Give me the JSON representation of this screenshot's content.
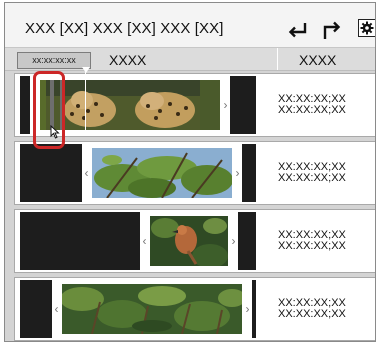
{
  "toolbar": {
    "title": "XXX [XX]  XXX [XX]  XXX [XX]",
    "icons": [
      "undo-arrow-icon",
      "redo-arrow-icon",
      "gear-icon"
    ]
  },
  "columns": {
    "timecode_chip": "xx:xx:xx:xx",
    "name": "XXXX",
    "time": "XXXX"
  },
  "rows": [
    {
      "thumbnail": "leopard-clip",
      "time_in": "XX:XX:XX;XX",
      "time_out": "XX:XX:XX;XX"
    },
    {
      "thumbnail": "tree-canopy-clip",
      "time_in": "XX:XX:XX;XX",
      "time_out": "XX:XX:XX;XX"
    },
    {
      "thumbnail": "bird-clip",
      "time_in": "XX:XX:XX;XX",
      "time_out": "XX:XX:XX;XX"
    },
    {
      "thumbnail": "jungle-clip",
      "time_in": "XX:XX:XX;XX",
      "time_out": "XX:XX:XX;XX"
    }
  ],
  "colors": {
    "selection_highlight": "#cc2727",
    "track_background": "#1d1d1d",
    "header_background": "#dcdcdc"
  }
}
